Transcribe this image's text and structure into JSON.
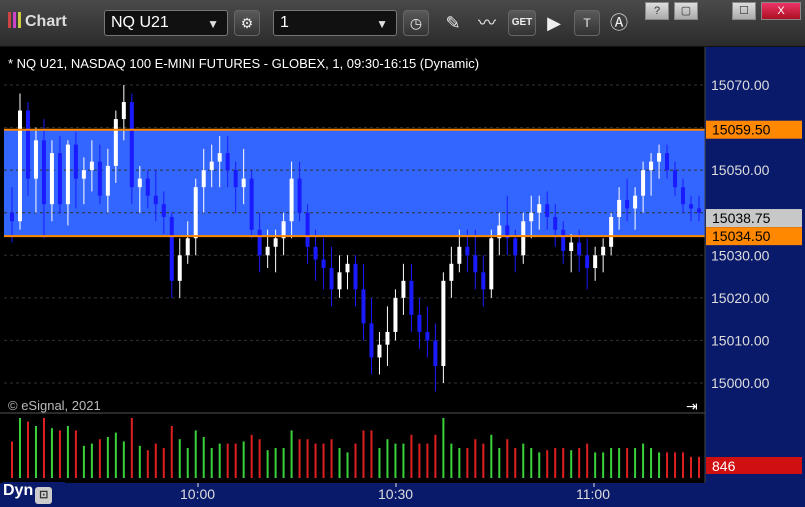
{
  "window": {
    "title": "Chart",
    "minimize": "?",
    "restore": "▢",
    "maximize": "☐",
    "close": "X"
  },
  "toolbar": {
    "symbol": "NQ U21",
    "interval": "1",
    "icons": [
      "gear-icon",
      "clock-icon",
      "pencil-icon",
      "study-icon",
      "get-icon",
      "play-icon",
      "text-tool-icon",
      "alert-icon"
    ],
    "get_label": "GET"
  },
  "chart": {
    "header": "* NQ U21, NASDAQ 100 E-MINI FUTURES - GLOBEX, 1, 09:30-16:15 (Dynamic)",
    "watermark": "© eSignal, 2021",
    "price_labels": [
      "15070.00",
      "15050.00",
      "15030.00",
      "15020.00",
      "15010.00",
      "15000.00"
    ],
    "level_high": "15059.50",
    "level_low": "15034.50",
    "last_price": "15038.75",
    "volume_label": "846",
    "time_labels": [
      "10:00",
      "10:30",
      "11:00"
    ],
    "footer_label": "Dyn",
    "colors": {
      "band": "#3366ff",
      "level": "#ff8800",
      "up": "#ffffff",
      "down": "#1a1aff",
      "vol_up": "#3ad23a",
      "vol_down": "#e02020",
      "axis": "#0a1a6a"
    }
  },
  "chart_data": {
    "type": "candlestick",
    "ylim": [
      14995,
      15075
    ],
    "level_band": [
      15034.5,
      15059.5
    ],
    "last": 15038.75,
    "candles": [
      [
        15040,
        15046,
        15033,
        15038
      ],
      [
        15038,
        15068,
        15036,
        15064
      ],
      [
        15064,
        15066,
        15044,
        15048
      ],
      [
        15048,
        15060,
        15040,
        15057
      ],
      [
        15057,
        15062,
        15034,
        15042
      ],
      [
        15042,
        15057,
        15038,
        15054
      ],
      [
        15054,
        15058,
        15040,
        15042
      ],
      [
        15042,
        15057,
        15037,
        15056
      ],
      [
        15056,
        15059,
        15041,
        15048
      ],
      [
        15048,
        15053,
        15042,
        15050
      ],
      [
        15050,
        15057,
        15045,
        15052
      ],
      [
        15052,
        15056,
        15042,
        15044
      ],
      [
        15044,
        15055,
        15040,
        15051
      ],
      [
        15051,
        15064,
        15047,
        15062
      ],
      [
        15062,
        15070,
        15057,
        15066
      ],
      [
        15066,
        15068,
        15042,
        15046
      ],
      [
        15046,
        15051,
        15040,
        15048
      ],
      [
        15048,
        15050,
        15041,
        15044
      ],
      [
        15044,
        15050,
        15038,
        15042
      ],
      [
        15042,
        15045,
        15035,
        15039
      ],
      [
        15039,
        15040,
        15020,
        15024
      ],
      [
        15024,
        15034,
        15020,
        15030
      ],
      [
        15030,
        15038,
        15028,
        15034
      ],
      [
        15034,
        15048,
        15030,
        15046
      ],
      [
        15046,
        15055,
        15040,
        15050
      ],
      [
        15050,
        15056,
        15046,
        15052
      ],
      [
        15052,
        15058,
        15046,
        15054
      ],
      [
        15054,
        15058,
        15046,
        15050
      ],
      [
        15050,
        15052,
        15040,
        15046
      ],
      [
        15046,
        15055,
        15042,
        15048
      ],
      [
        15048,
        15050,
        15034,
        15036
      ],
      [
        15036,
        15040,
        15026,
        15030
      ],
      [
        15030,
        15036,
        15027,
        15032
      ],
      [
        15032,
        15036,
        15026,
        15034
      ],
      [
        15034,
        15040,
        15030,
        15038
      ],
      [
        15038,
        15052,
        15034,
        15048
      ],
      [
        15048,
        15052,
        15038,
        15040
      ],
      [
        15040,
        15042,
        15028,
        15032
      ],
      [
        15032,
        15036,
        15024,
        15029
      ],
      [
        15029,
        15034,
        15022,
        15027
      ],
      [
        15027,
        15032,
        15018,
        15022
      ],
      [
        15022,
        15030,
        15020,
        15026
      ],
      [
        15026,
        15030,
        15022,
        15028
      ],
      [
        15028,
        15030,
        15018,
        15022
      ],
      [
        15022,
        15028,
        15010,
        15014
      ],
      [
        15014,
        15020,
        15002,
        15006
      ],
      [
        15006,
        15012,
        15002,
        15009
      ],
      [
        15009,
        15018,
        15004,
        15012
      ],
      [
        15012,
        15022,
        15010,
        15020
      ],
      [
        15020,
        15028,
        15016,
        15024
      ],
      [
        15024,
        15028,
        15012,
        15016
      ],
      [
        15016,
        15020,
        15008,
        15012
      ],
      [
        15012,
        15018,
        15006,
        15010
      ],
      [
        15010,
        15014,
        14998,
        15004
      ],
      [
        15004,
        15026,
        15000,
        15024
      ],
      [
        15024,
        15032,
        15020,
        15028
      ],
      [
        15028,
        15036,
        15026,
        15032
      ],
      [
        15032,
        15036,
        15026,
        15030
      ],
      [
        15030,
        15036,
        15022,
        15026
      ],
      [
        15026,
        15030,
        15018,
        15022
      ],
      [
        15022,
        15036,
        15020,
        15034
      ],
      [
        15034,
        15040,
        15030,
        15037
      ],
      [
        15037,
        15044,
        15030,
        15034
      ],
      [
        15034,
        15036,
        15026,
        15030
      ],
      [
        15030,
        15040,
        15028,
        15038
      ],
      [
        15038,
        15044,
        15034,
        15040
      ],
      [
        15040,
        15044,
        15036,
        15042
      ],
      [
        15042,
        15045,
        15036,
        15039
      ],
      [
        15039,
        15042,
        15032,
        15036
      ],
      [
        15036,
        15038,
        15028,
        15031
      ],
      [
        15031,
        15035,
        15026,
        15033
      ],
      [
        15033,
        15036,
        15026,
        15030
      ],
      [
        15030,
        15034,
        15022,
        15027
      ],
      [
        15027,
        15032,
        15024,
        15030
      ],
      [
        15030,
        15034,
        15026,
        15032
      ],
      [
        15032,
        15040,
        15030,
        15039
      ],
      [
        15039,
        15046,
        15036,
        15043
      ],
      [
        15043,
        15048,
        15038,
        15041
      ],
      [
        15041,
        15046,
        15036,
        15044
      ],
      [
        15044,
        15052,
        15040,
        15050
      ],
      [
        15050,
        15054,
        15044,
        15052
      ],
      [
        15052,
        15056,
        15048,
        15054
      ],
      [
        15054,
        15056,
        15048,
        15050
      ],
      [
        15050,
        15052,
        15044,
        15046
      ],
      [
        15046,
        15048,
        15040,
        15042
      ],
      [
        15042,
        15044,
        15038,
        15041
      ],
      [
        15041,
        15044,
        15038,
        15040
      ]
    ],
    "volume_range": [
      0,
      100
    ]
  }
}
